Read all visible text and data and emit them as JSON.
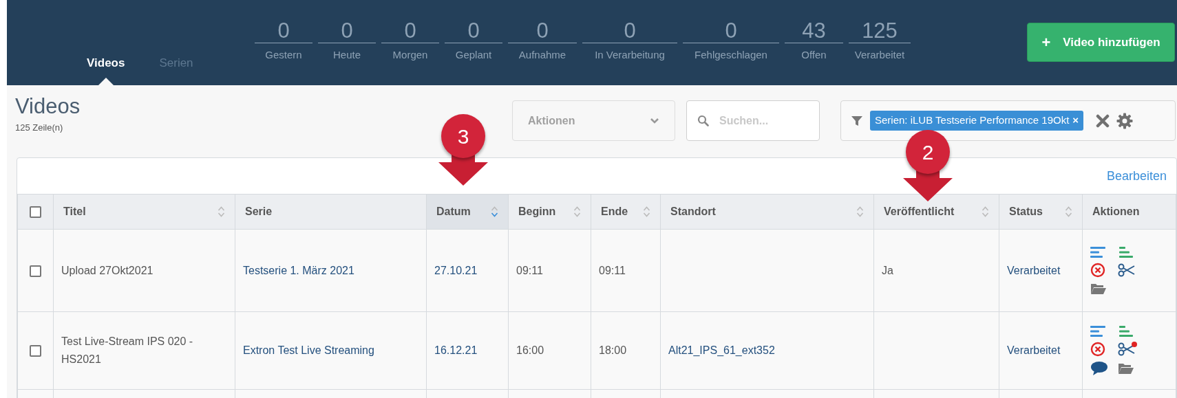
{
  "header": {
    "tabs": [
      {
        "label": "Videos",
        "selected": true
      },
      {
        "label": "Serien",
        "selected": false
      }
    ],
    "counters": [
      {
        "value": "0",
        "label": "Gestern"
      },
      {
        "value": "0",
        "label": "Heute"
      },
      {
        "value": "0",
        "label": "Morgen"
      },
      {
        "value": "0",
        "label": "Geplant"
      },
      {
        "value": "0",
        "label": "Aufnahme"
      },
      {
        "value": "0",
        "label": "In Verarbeitung"
      },
      {
        "value": "0",
        "label": "Fehlgeschlagen"
      },
      {
        "value": "43",
        "label": "Offen"
      },
      {
        "value": "125",
        "label": "Verarbeitet"
      }
    ],
    "add_button": {
      "icon": "+",
      "label": "Video hinzufügen"
    }
  },
  "page": {
    "title": "Videos",
    "row_count": "125 Zeile(n)"
  },
  "toolbar": {
    "actions_dropdown": {
      "placeholder": "Aktionen"
    },
    "search": {
      "placeholder": "Suchen..."
    },
    "filter_chip": {
      "label": "Serien: iLUB Testserie Performance 19Okt",
      "remove": "×"
    }
  },
  "table": {
    "edit_link": "Bearbeiten",
    "select_all": {
      "checked": false
    },
    "columns": [
      {
        "label": "Titel",
        "sorted": false,
        "link": false
      },
      {
        "label": "Serie",
        "link": true
      },
      {
        "label": "Datum",
        "sorted": true,
        "link": true
      },
      {
        "label": "Beginn",
        "sorted": false,
        "link": false
      },
      {
        "label": "Ende",
        "sorted": false,
        "link": false
      },
      {
        "label": "Standort",
        "sorted": false,
        "link": true
      },
      {
        "label": "Veröffentlicht",
        "sorted": false,
        "link": false
      },
      {
        "label": "Status",
        "sorted": false,
        "link": true
      },
      {
        "label": "Aktionen"
      }
    ],
    "rows": [
      {
        "checked": false,
        "cells": [
          "Upload 27Okt2021",
          "Testserie 1. März 2021",
          "27.10.21",
          "09:11",
          "09:11",
          null,
          "Ja",
          "Verarbeitet"
        ],
        "actions": [
          {
            "kind": "text-lines"
          },
          {
            "kind": "stepped-lines"
          },
          {
            "kind": "cancel"
          },
          {
            "kind": "scissors",
            "badge": false
          },
          {
            "kind": "folder"
          }
        ]
      },
      {
        "checked": false,
        "cells": [
          "Test Live-Stream IPS 020 - HS2021",
          "Extron Test Live Streaming",
          "16.12.21",
          "16:00",
          "18:00",
          "Alt21_IPS_61_ext352",
          null,
          "Verarbeitet"
        ],
        "actions": [
          {
            "kind": "text-lines"
          },
          {
            "kind": "stepped-lines"
          },
          {
            "kind": "cancel"
          },
          {
            "kind": "scissors",
            "badge": true
          },
          {
            "kind": "comment"
          },
          {
            "kind": "folder"
          }
        ]
      }
    ]
  },
  "annotations": [
    {
      "label": "3"
    },
    {
      "label": "2"
    }
  ]
}
